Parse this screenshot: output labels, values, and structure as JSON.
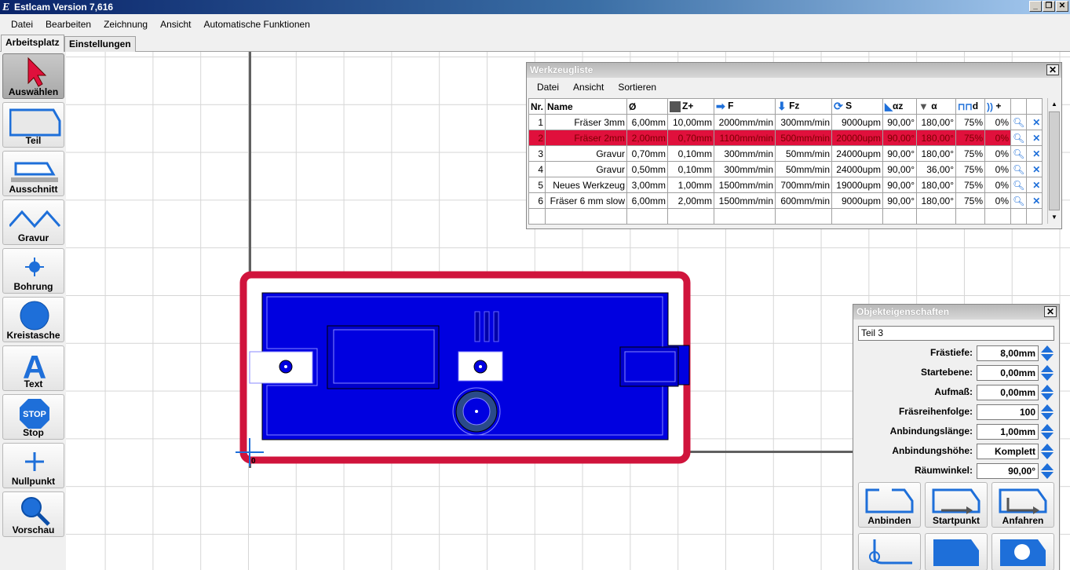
{
  "window": {
    "title": "Estlcam Version 7,616",
    "app_icon": "E"
  },
  "menu": [
    "Datei",
    "Bearbeiten",
    "Zeichnung",
    "Ansicht",
    "Automatische Funktionen"
  ],
  "tabs": {
    "active": "Arbeitsplatz",
    "inactive": "Einstellungen"
  },
  "toolbar": [
    {
      "label": "Auswählen",
      "icon": "cursor-arrow-icon"
    },
    {
      "label": "Teil",
      "icon": "part-icon"
    },
    {
      "label": "Ausschnitt",
      "icon": "cutout-icon"
    },
    {
      "label": "Gravur",
      "icon": "engrave-icon"
    },
    {
      "label": "Bohrung",
      "icon": "drill-icon"
    },
    {
      "label": "Kreistasche",
      "icon": "circle-pocket-icon"
    },
    {
      "label": "Text",
      "icon": "text-icon"
    },
    {
      "label": "Stop",
      "icon": "stop-icon"
    },
    {
      "label": "Nullpunkt",
      "icon": "origin-icon"
    },
    {
      "label": "Vorschau",
      "icon": "magnifier-icon"
    }
  ],
  "origin_label": "0",
  "tool_list": {
    "title": "Werkzeugliste",
    "menu": [
      "Datei",
      "Ansicht",
      "Sortieren"
    ],
    "headers": [
      "Nr.",
      "Name",
      "Ø",
      "Z+",
      "F",
      "Fz",
      "S",
      "αz",
      "α",
      "d",
      "+"
    ],
    "rows": [
      [
        "1",
        "Fräser 3mm",
        "6,00mm",
        "10,00mm",
        "2000mm/min",
        "300mm/min",
        "9000upm",
        "90,00°",
        "180,00°",
        "75%",
        "0%"
      ],
      [
        "2",
        "Fräser 2mm",
        "2,00mm",
        "0,70mm",
        "1100mm/min",
        "500mm/min",
        "20000upm",
        "90,00°",
        "180,00°",
        "75%",
        "0%"
      ],
      [
        "3",
        "Gravur",
        "0,70mm",
        "0,10mm",
        "300mm/min",
        "50mm/min",
        "24000upm",
        "90,00°",
        "180,00°",
        "75%",
        "0%"
      ],
      [
        "4",
        "Gravur",
        "0,50mm",
        "0,10mm",
        "300mm/min",
        "50mm/min",
        "24000upm",
        "90,00°",
        "36,00°",
        "75%",
        "0%"
      ],
      [
        "5",
        "Neues Werkzeug",
        "3,00mm",
        "1,00mm",
        "1500mm/min",
        "700mm/min",
        "19000upm",
        "90,00°",
        "180,00°",
        "75%",
        "0%"
      ],
      [
        "6",
        "Fräser 6 mm slow",
        "6,00mm",
        "2,00mm",
        "1500mm/min",
        "600mm/min",
        "9000upm",
        "90,00°",
        "180,00°",
        "75%",
        "0%"
      ]
    ],
    "selected_row": 2
  },
  "properties": {
    "title": "Objekteigenschaften",
    "name": "Teil 3",
    "fields": [
      {
        "label": "Frästiefe:",
        "value": "8,00mm"
      },
      {
        "label": "Startebene:",
        "value": "0,00mm"
      },
      {
        "label": "Aufmaß:",
        "value": "0,00mm"
      },
      {
        "label": "Fräsreihenfolge:",
        "value": "100"
      },
      {
        "label": "Anbindungslänge:",
        "value": "1,00mm"
      },
      {
        "label": "Anbindungshöhe:",
        "value": "Komplett"
      },
      {
        "label": "Räumwinkel:",
        "value": "90,00°"
      }
    ],
    "buttons": [
      "Anbinden",
      "Startpunkt",
      "Anfahren"
    ],
    "close_icon": "✕"
  },
  "colors": {
    "accent_blue": "#1e6fd9",
    "part_fill": "#0000e0",
    "selection_red": "#e0103c",
    "outline_red": "#d0143c"
  }
}
